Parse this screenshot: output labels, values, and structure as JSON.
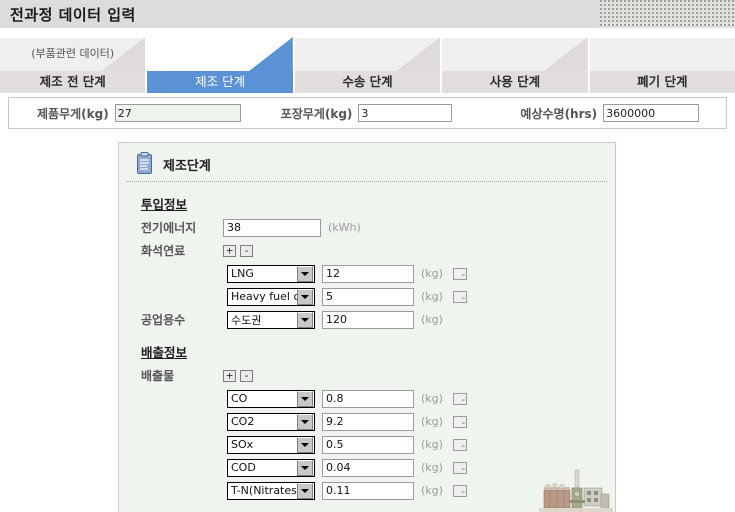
{
  "header": {
    "title": "전과정 데이터 입력",
    "dots_icon": "dotted-texture"
  },
  "tabs": [
    {
      "sub": "(부품관련 데이터)",
      "label": "제조 전 단계",
      "active": false,
      "triangle": true
    },
    {
      "sub": "",
      "label": "제조 단계",
      "active": true,
      "triangle": true
    },
    {
      "sub": "",
      "label": "수송 단계",
      "active": false,
      "triangle": true
    },
    {
      "sub": "",
      "label": "사용 단계",
      "active": false,
      "triangle": true
    },
    {
      "sub": "",
      "label": "폐기 단계",
      "active": false,
      "triangle": false
    }
  ],
  "summary": {
    "fields": [
      {
        "label": "제품무게(kg)",
        "value": "27",
        "readonly": true
      },
      {
        "label": "포장무게(kg)",
        "value": "3",
        "readonly": false
      },
      {
        "label": "예상수명(hrs)",
        "value": "3600000",
        "readonly": false
      }
    ]
  },
  "panel": {
    "icon": "clipboard-icon",
    "title": "제조단계",
    "input_section": {
      "title": "투입정보",
      "electric": {
        "label": "전기에너지",
        "value": "38",
        "unit": "(kWh)"
      },
      "fossil": {
        "label": "화석연료",
        "add_label": "+",
        "remove_label": "-",
        "rows": [
          {
            "select": "LNG",
            "value": "12",
            "unit": "(kg)",
            "remove": "-"
          },
          {
            "select": "Heavy fuel oil",
            "value": "5",
            "unit": "(kg)",
            "remove": "-"
          }
        ]
      },
      "water": {
        "label": "공업용수",
        "select": "수도권",
        "value": "120",
        "unit": "(kg)"
      }
    },
    "emission_section": {
      "title": "배출정보",
      "emissions": {
        "label": "배출물",
        "add_label": "+",
        "remove_label": "-",
        "rows": [
          {
            "select": "CO",
            "value": "0.8",
            "unit": "(kg)",
            "remove": "-"
          },
          {
            "select": "CO2",
            "value": "9.2",
            "unit": "(kg)",
            "remove": "-"
          },
          {
            "select": "SOx",
            "value": "0.5",
            "unit": "(kg)",
            "remove": "-"
          },
          {
            "select": "COD",
            "value": "0.04",
            "unit": "(kg)",
            "remove": "-"
          },
          {
            "select": "T-N(Nitrates)",
            "value": "0.11",
            "unit": "(kg)",
            "remove": "-"
          }
        ]
      }
    },
    "factory_image": "factory-plant-illustration"
  },
  "colors": {
    "active_tab": "#5b92d6",
    "inactive_tab": "#e2dde1",
    "panel_bg": "#eff4ef",
    "header_bg": "#dcdcdc"
  }
}
